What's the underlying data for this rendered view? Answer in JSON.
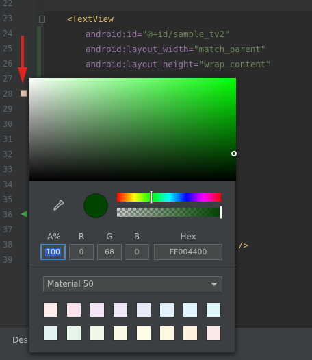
{
  "editor": {
    "line_numbers": [
      "22",
      "23",
      "24",
      "25",
      "26",
      "27",
      "28",
      "29",
      "30",
      "31",
      "32",
      "33",
      "34",
      "35",
      "36",
      "37",
      "38",
      "39"
    ],
    "code_lines": [
      {
        "tag_open": "<TextView"
      },
      {
        "ns": "android:id=",
        "value": "\"@+id/sample_tv2\""
      },
      {
        "ns": "android:layout_width=",
        "value": "\"match_parent\""
      },
      {
        "ns": "android:layout_height=",
        "value": "\"wrap_content\""
      }
    ],
    "tag_close": "/>",
    "bottom_tab": "Desi"
  },
  "picker": {
    "color_hex": "#004400",
    "labels": {
      "alpha": "A%",
      "r": "R",
      "g": "G",
      "b": "B",
      "hex": "Hex"
    },
    "values": {
      "alpha": "100",
      "r": "0",
      "g": "68",
      "b": "0",
      "hex": "FF004400"
    },
    "hue_position": 0.33,
    "alpha_level": 1.0,
    "palette": {
      "selected": "Material 50",
      "swatches": [
        "#fdecea",
        "#fce4ec",
        "#f3e5f5",
        "#ede7f6",
        "#e8eaf6",
        "#e3f2fd",
        "#e1f5fe",
        "#e0f7fa",
        "#e0f2f1",
        "#e8f5e9",
        "#f1f8e9",
        "#f9fbe7",
        "#fffde7",
        "#fff8e1",
        "#fff3e0",
        "#fbe9e7"
      ]
    }
  }
}
